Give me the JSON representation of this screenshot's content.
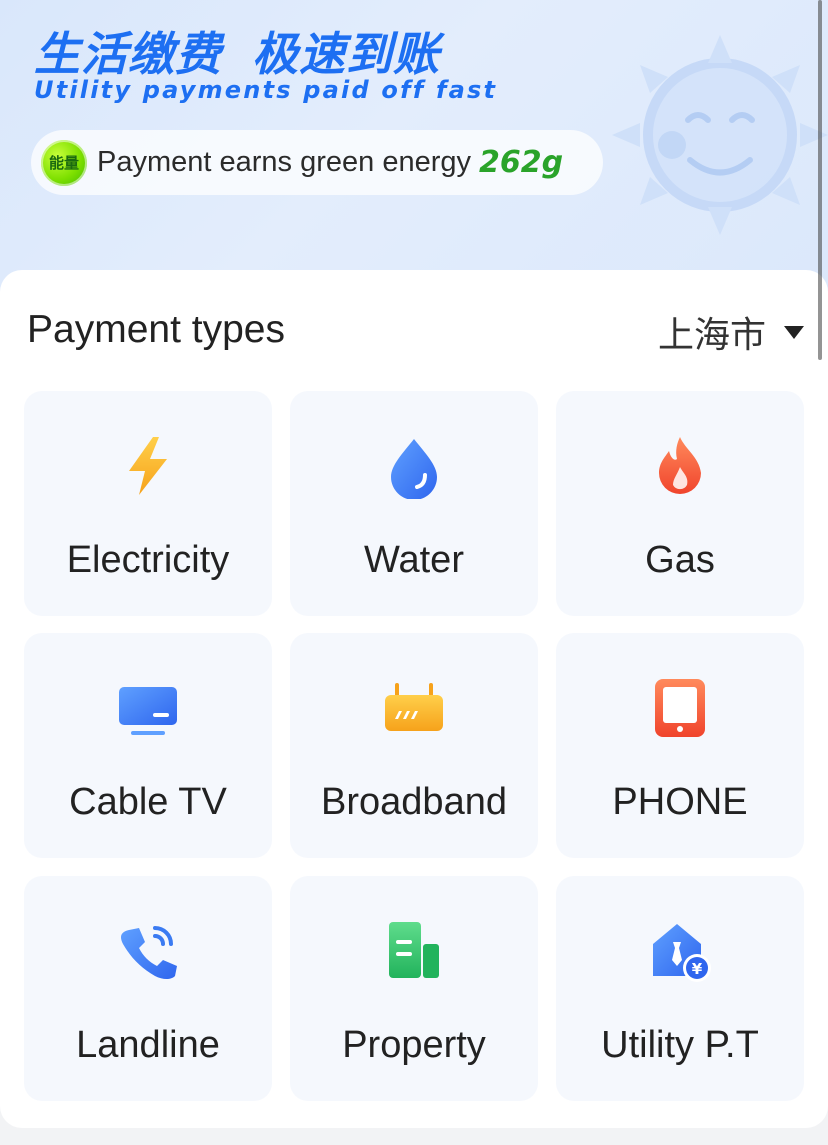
{
  "banner": {
    "cn_title_part1": "生活缴费",
    "cn_title_part2": "极速到账",
    "en_subtitle": "Utility payments paid off fast",
    "energy_badge_text": "能量",
    "energy_text": "Payment earns green energy",
    "energy_value": "262g"
  },
  "section": {
    "title": "Payment types",
    "city": "上海市"
  },
  "tiles": [
    {
      "label": "Electricity",
      "icon": "lightning-icon",
      "color": "#f7b32b"
    },
    {
      "label": "Water",
      "icon": "water-drop-icon",
      "color": "#3b7bf2"
    },
    {
      "label": "Gas",
      "icon": "flame-icon",
      "color": "#f25a3b"
    },
    {
      "label": "Cable TV",
      "icon": "tv-icon",
      "color": "#3b7bf2"
    },
    {
      "label": "Broadband",
      "icon": "router-icon",
      "color": "#f7b32b"
    },
    {
      "label": "PHONE",
      "icon": "mobile-phone-icon",
      "color": "#f25a3b"
    },
    {
      "label": "Landline",
      "icon": "telephone-icon",
      "color": "#3b7bf2"
    },
    {
      "label": "Property",
      "icon": "building-icon",
      "color": "#2fc06a"
    },
    {
      "label": "Utility P.T",
      "icon": "house-yuan-icon",
      "color": "#3b7bf2"
    }
  ],
  "colors": {
    "brand_blue": "#1d6ff2",
    "energy_green": "#2aa32a",
    "tile_bg": "#f5f8fd"
  }
}
